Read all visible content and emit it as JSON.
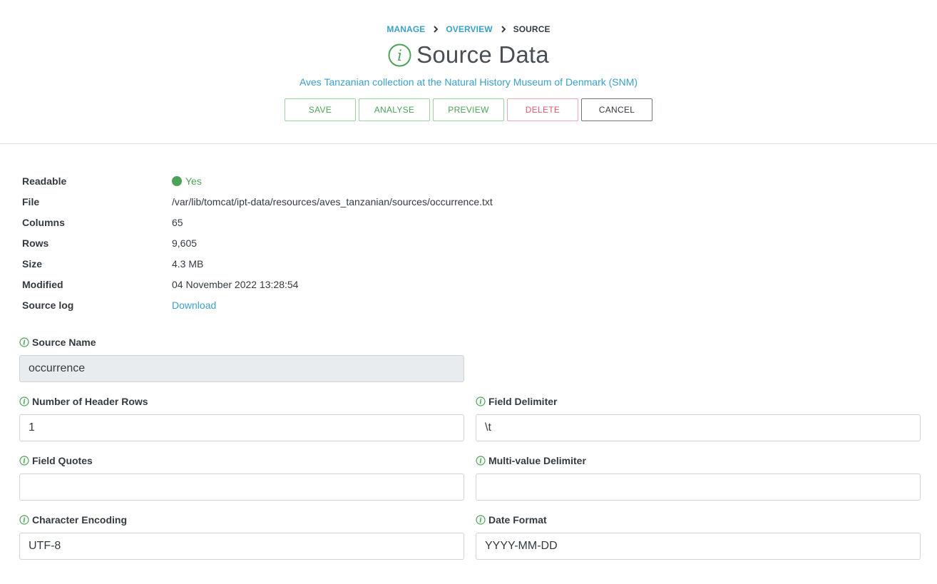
{
  "breadcrumb": {
    "items": [
      "MANAGE",
      "OVERVIEW",
      "SOURCE"
    ]
  },
  "page": {
    "title": "Source Data",
    "subtitle": "Aves Tanzanian collection at the Natural History Museum of Denmark (SNM)",
    "title_icon": "info-circle-icon"
  },
  "actions": {
    "save": "SAVE",
    "analyse": "ANALYSE",
    "preview": "PREVIEW",
    "delete": "DELETE",
    "cancel": "CANCEL"
  },
  "details": {
    "readable_label": "Readable",
    "readable_value": "Yes",
    "file_label": "File",
    "file_value": "/var/lib/tomcat/ipt-data/resources/aves_tanzanian/sources/occurrence.txt",
    "columns_label": "Columns",
    "columns_value": "65",
    "rows_label": "Rows",
    "rows_value": "9,605",
    "size_label": "Size",
    "size_value": "4.3 MB",
    "modified_label": "Modified",
    "modified_value": "04 November 2022 13:28:54",
    "sourcelog_label": "Source log",
    "sourcelog_value": "Download"
  },
  "form": {
    "source_name": {
      "label": "Source Name",
      "value": "occurrence"
    },
    "header_rows": {
      "label": "Number of Header Rows",
      "value": "1"
    },
    "field_delimiter": {
      "label": "Field Delimiter",
      "value": "\\t"
    },
    "field_quotes": {
      "label": "Field Quotes",
      "value": ""
    },
    "multivalue_delimiter": {
      "label": "Multi-value Delimiter",
      "value": ""
    },
    "character_encoding": {
      "label": "Character Encoding",
      "value": "UTF-8"
    },
    "date_format": {
      "label": "Date Format",
      "value": "YYYY-MM-DD"
    }
  },
  "colors": {
    "accent_blue": "#3a9fc9",
    "success_green": "#4ca356",
    "danger_red": "#e05a6c"
  }
}
